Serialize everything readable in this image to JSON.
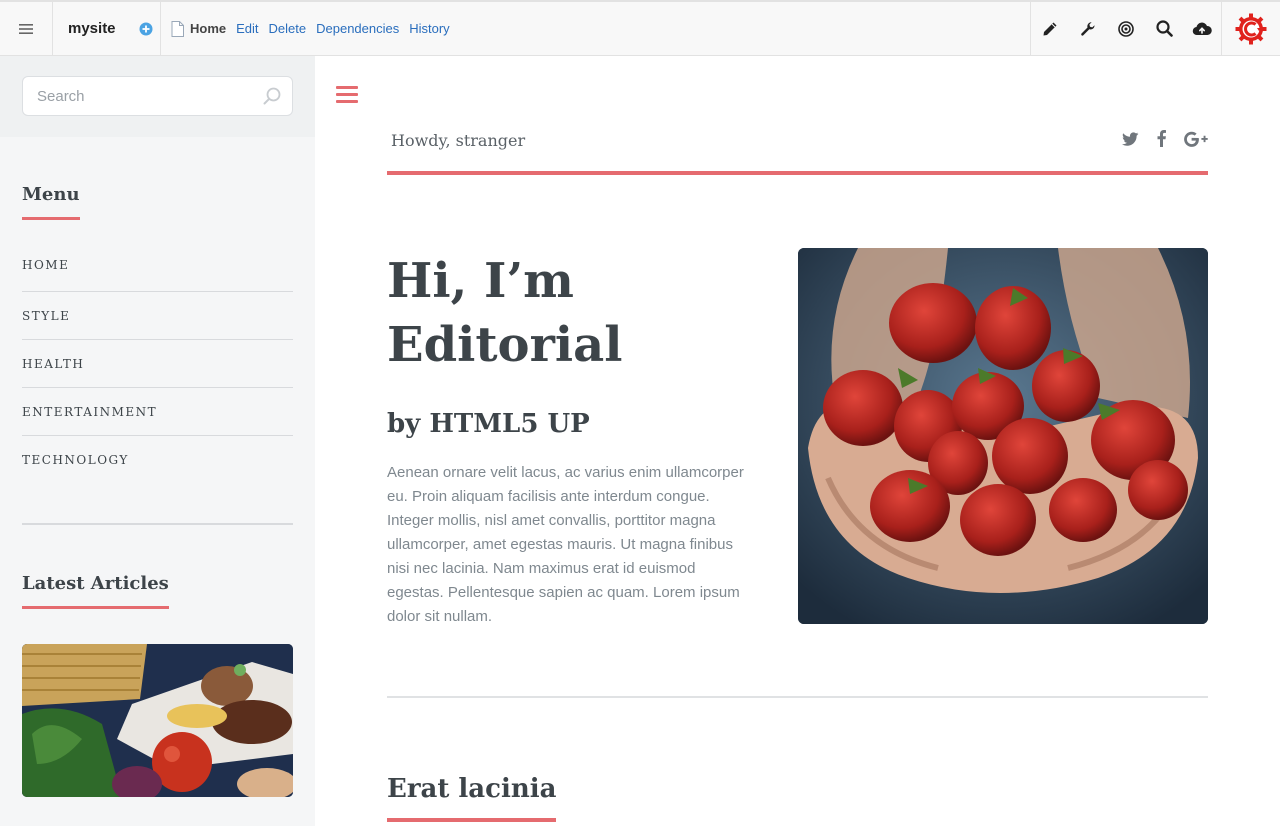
{
  "topbar": {
    "site_name": "mysite",
    "page_label": "Home",
    "links": [
      "Edit",
      "Delete",
      "Dependencies",
      "History"
    ]
  },
  "sidebar": {
    "search_placeholder": "Search",
    "menu_title": "Menu",
    "menu_items": [
      "HOME",
      "STYLE",
      "HEALTH",
      "ENTERTAINMENT",
      "TECHNOLOGY"
    ],
    "latest_title": "Latest Articles"
  },
  "main": {
    "greeting": "Howdy, stranger",
    "hero_title_line1": "Hi, I’m",
    "hero_title_line2": "Editorial",
    "hero_subtitle": "by HTML5 UP",
    "hero_paragraph": "Aenean ornare velit lacus, ac varius enim ullamcorper eu. Proin aliquam facilisis ante interdum congue. Integer mollis, nisl amet convallis, porttitor magna ullamcorper, amet egestas mauris. Ut magna finibus nisi nec lacinia. Nam maximus erat id euismod egestas. Pellentesque sapien ac quam. Lorem ipsum dolor sit nullam.",
    "section_title": "Erat lacinia"
  },
  "colors": {
    "accent": "#e56b6f",
    "link": "#2a6ebd",
    "text": "#3d4449"
  },
  "icons": {
    "topbar": [
      "hamburger-icon",
      "add-icon",
      "document-icon",
      "pencil-icon",
      "wrench-icon",
      "target-icon",
      "search-icon",
      "cloud-upload-icon",
      "logo-icon"
    ],
    "social": [
      "twitter-icon",
      "facebook-icon",
      "google-plus-icon"
    ]
  }
}
